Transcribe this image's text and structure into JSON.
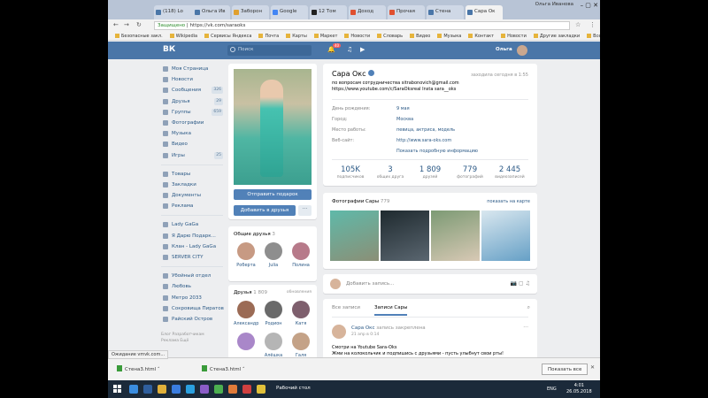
{
  "browser": {
    "tabs": [
      {
        "label": "(118) Lo"
      },
      {
        "label": "Ольга Ив"
      },
      {
        "label": "Заборон"
      },
      {
        "label": "Google"
      },
      {
        "label": "12 Том"
      },
      {
        "label": "Доход"
      },
      {
        "label": "Прочая"
      },
      {
        "label": "Стена"
      },
      {
        "label": "Сара Ок"
      }
    ],
    "window_user": "Ольга Иванова",
    "secure_label": "Защищено",
    "url": "https://vk.com/saraoks",
    "bookmarks": [
      "Безопасные закл.",
      "Wikipedia",
      "Сервисы Яндекса",
      "Почта",
      "Карты",
      "Маркет",
      "Новости",
      "Словарь",
      "Видео",
      "Музыка",
      "Контакт",
      "Новости",
      "Другие закладки",
      "Все для О.С."
    ]
  },
  "vk_header": {
    "logo": "ВК",
    "search_placeholder": "Поиск",
    "notif_count": "40",
    "user_name": "Ольга"
  },
  "left_nav": {
    "items": [
      {
        "label": "Моя Страница",
        "count": ""
      },
      {
        "label": "Новости",
        "count": ""
      },
      {
        "label": "Сообщения",
        "count": "326"
      },
      {
        "label": "Друзья",
        "count": "29"
      },
      {
        "label": "Группы",
        "count": "659"
      },
      {
        "label": "Фотографии",
        "count": ""
      },
      {
        "label": "Музыка",
        "count": ""
      },
      {
        "label": "Видео",
        "count": ""
      },
      {
        "label": "Игры",
        "count": "25"
      }
    ],
    "items2": [
      {
        "label": "Товары"
      },
      {
        "label": "Закладки"
      },
      {
        "label": "Документы"
      },
      {
        "label": "Реклама"
      }
    ],
    "items3": [
      {
        "label": "Lady GaGa"
      },
      {
        "label": "Я Дарю Подарк..."
      },
      {
        "label": "Клан - Lady GaGa"
      },
      {
        "label": "SERVER CITY"
      }
    ],
    "items4": [
      {
        "label": "Убойный отдел"
      },
      {
        "label": "Любовь"
      },
      {
        "label": "Метро 2033"
      },
      {
        "label": "Сокровища Пиратов"
      },
      {
        "label": "Райский Остров"
      }
    ],
    "footer": "Блог  Разработчикам\nРеклама  Ещё"
  },
  "profile": {
    "send_gift": "Отправить подарок",
    "add_friend": "Добавить в друзья",
    "more": "···",
    "mutual_title": "Общие друзья",
    "mutual_count": "3",
    "mutual": [
      {
        "name": "Роберта",
        "color": "#c79a83"
      },
      {
        "name": "Julia",
        "color": "#8e8e8e"
      },
      {
        "name": "Полина",
        "color": "#b77a8a"
      }
    ],
    "friends_title": "Друзья",
    "friends_count": "1 809",
    "friends_update": "обновления",
    "friends": [
      {
        "name": "Александр",
        "color": "#9b6b55"
      },
      {
        "name": "Родион",
        "color": "#6a6a6a"
      },
      {
        "name": "Катя",
        "color": "#7e5f6d"
      },
      {
        "name": "",
        "color": "#a987c9"
      },
      {
        "name": "Алёшка",
        "color": "#b5b5b5"
      },
      {
        "name": "Галя",
        "color": "#c4a287"
      }
    ]
  },
  "info": {
    "name": "Сара Окс",
    "online": "заходила сегодня в 1:55",
    "status": "по вопросам сотрудничества sitrabonovich@gmail.com\nhttps://www.youtube.com/c/SaraOksreal Insta sara__oks",
    "rows": [
      {
        "k": "День рождения:",
        "v": "9 мая"
      },
      {
        "k": "Город:",
        "v": "Москва"
      },
      {
        "k": "Место работы:",
        "v": "певица, актриса, модель"
      },
      {
        "k": "Веб-сайт:",
        "v": "http://www.sara-oks.com"
      }
    ],
    "show_more": "Показать подробную информацию",
    "counters": [
      {
        "n": "105K",
        "l": "подписчиков"
      },
      {
        "n": "3",
        "l": "общих друга"
      },
      {
        "n": "1 809",
        "l": "друзей"
      },
      {
        "n": "779",
        "l": "фотографий"
      },
      {
        "n": "2 445",
        "l": "видеозаписей"
      }
    ]
  },
  "photos": {
    "title": "Фотографии Сары",
    "count": "779",
    "map_link": "показать на карте",
    "thumbs": [
      {
        "c1": "#5fb9a9",
        "c2": "#8b8f76"
      },
      {
        "c1": "#1f2a2f",
        "c2": "#5a6670"
      },
      {
        "c1": "#7c9a74",
        "c2": "#d8c9b5"
      },
      {
        "c1": "#d9e7ef",
        "c2": "#66a0c6"
      }
    ]
  },
  "post_box": {
    "placeholder": "Добавить запись..."
  },
  "wall": {
    "tab_all": "Все записи",
    "tab_own": "Записи Сары",
    "author": "Сара Окс",
    "pinned": "запись закреплена",
    "time": "21 апр в 0:14",
    "text": "Смотри на Youtube Sara-Oks\nЖми на колокольчик и подпишись с друзьями - пусть улыбнут свои рты!"
  },
  "downloads": {
    "status": "Ожидание vmvk.com...",
    "items": [
      "Стена3.html",
      "Стена3.html"
    ],
    "show_all": "Показать все"
  },
  "taskbar": {
    "desktop": "Рабочий стол",
    "lang": "ENG",
    "time": "4:01",
    "date": "26.05.2018"
  }
}
